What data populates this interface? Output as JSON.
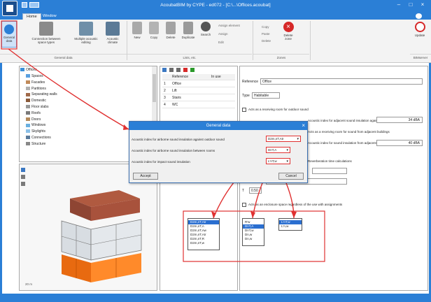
{
  "window": {
    "title": "AcoubatBIM by CYPE - ed072 - [C:\\...\\Offices.acoubat]",
    "tabs": [
      "Home",
      "Window"
    ]
  },
  "ribbon": {
    "groups": [
      {
        "label": "General data",
        "buttons": [
          "General data"
        ]
      },
      {
        "label": "",
        "buttons": [
          "Connection between space types",
          "Multiple acoustic editing",
          "Acoustic climate"
        ]
      },
      {
        "label": "Lists, etc.",
        "buttons": [
          "New",
          "Copy",
          "Delete",
          "Duplicate",
          "Search"
        ]
      },
      {
        "label": "",
        "buttons": [
          "Assign element",
          "Assign",
          "Edit"
        ]
      },
      {
        "label": "Zones",
        "buttons": [
          "Copy",
          "Paste",
          "Delete",
          "Editing",
          "Delete zone"
        ]
      },
      {
        "label": "BIMserver",
        "buttons": [
          "Update"
        ]
      }
    ]
  },
  "tree": {
    "root": "Offices",
    "items": [
      "Spaces",
      "Facades",
      "Partitions",
      "Separating walls",
      "Domestic",
      "Floor slabs",
      "Roofs",
      "Doors",
      "Windows",
      "Skylights",
      "Connections",
      "Structure"
    ]
  },
  "list": {
    "columns": [
      "Reference",
      "In use"
    ],
    "rows": [
      {
        "n": "1",
        "name": "Office"
      },
      {
        "n": "2",
        "name": "Lift"
      },
      {
        "n": "3",
        "name": "Stairs"
      },
      {
        "n": "4",
        "name": "WC"
      }
    ]
  },
  "properties": {
    "reference_label": "Reference",
    "reference_value": "Office",
    "type_label": "Type",
    "type_value": "Habitable",
    "check1": "Acts as a receiving room for outdoor sound",
    "adj_text": "Acoustic index for adjacent sound insulation against outdoor sound, D2m,nT,Atr",
    "adj_value": "34 dBA",
    "check2": "Acts as a receiving room for sound from adjacent buildings",
    "adj_text2": "Acoustic index for sound insulation from adjacent buildings, DnT,A",
    "adj_value2": "40 dBA",
    "reverb_text": "Reverberation time calculations",
    "ti_label": "T",
    "ti_value": "0.50",
    "check3": "Acts as an enclosure space regardless of the use with assignments"
  },
  "dialog": {
    "title": "General data",
    "row1_label": "Acoustic index for airborne sound insulation against outdoor sound",
    "row1_value": "D2m,nT,Atr",
    "row2_label": "Acoustic index for airborne sound insulation between rooms",
    "row2_value": "DnT,A",
    "row3_label": "Acoustic index for impact sound insulation",
    "row3_value": "L'nT,w",
    "accept": "Accept",
    "cancel": "Cancel"
  },
  "dropdowns": {
    "list1": [
      "D2m,nT,Atr",
      "D2m,nT,A",
      "D2m,nT,Aw",
      "D2m,nT,Atr",
      "D2m,nT,R",
      "D2m,nT,w"
    ],
    "list1_selected": 0,
    "list2": [
      "R'w",
      "DnT,A",
      "DnT,w",
      "Dn,w",
      "Dn,w"
    ],
    "list2_selected": 1,
    "list3": [
      "L'nT,w",
      "L'n,w"
    ],
    "list3_selected": 0
  },
  "view3d": {
    "scale_label": "20 m"
  },
  "colors": {
    "accent": "#2b7fd6",
    "callout": "#e03131",
    "orange_mass": "#ff7a1a",
    "brick": "#9c4a3a"
  }
}
